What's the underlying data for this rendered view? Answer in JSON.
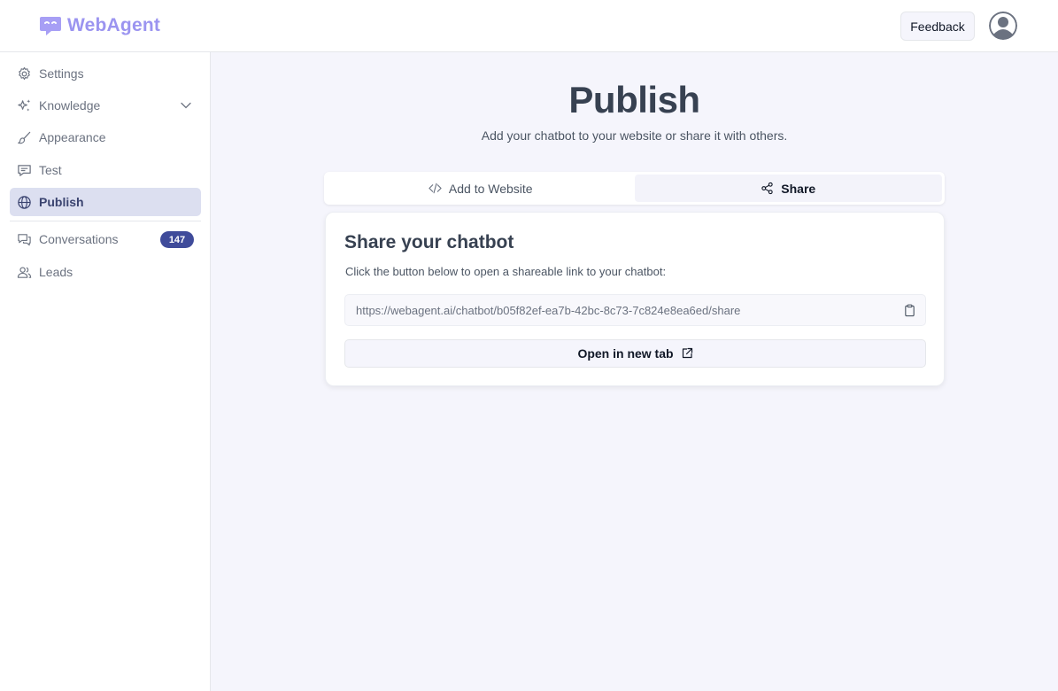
{
  "app": {
    "brand": "WebAgent",
    "brand_color": "#9b94f0",
    "accent_color": "#3f4b9a"
  },
  "header": {
    "feedback_label": "Feedback",
    "avatar_icon": "user-avatar-icon"
  },
  "sidebar": {
    "items": [
      {
        "label": "Settings",
        "icon": "gear-icon"
      },
      {
        "label": "Knowledge",
        "icon": "sparkles-icon"
      },
      {
        "label": "Appearance",
        "icon": "brush-icon"
      },
      {
        "label": "Test",
        "icon": "chat-icon"
      },
      {
        "label": "Publish",
        "icon": "globe-icon",
        "active": true
      },
      {
        "label": "Conversations",
        "icon": "conversations-icon",
        "badge": "147"
      },
      {
        "label": "Leads",
        "icon": "users-icon"
      }
    ]
  },
  "main": {
    "title": "Publish",
    "subtitle": "Add your chatbot to your website or share it with others.",
    "tabs": [
      {
        "label": "Add to Website",
        "icon": "code-icon"
      },
      {
        "label": "Share",
        "icon": "share-icon",
        "active": true
      }
    ],
    "card": {
      "title": "Share your chatbot",
      "description": "Click the button below to open a shareable link to your chatbot:",
      "url": "https://webagent.ai/chatbot/b05f82ef-ea7b-42bc-8c73-7c824e8ea6ed/share",
      "open_label": "Open in new tab"
    }
  }
}
